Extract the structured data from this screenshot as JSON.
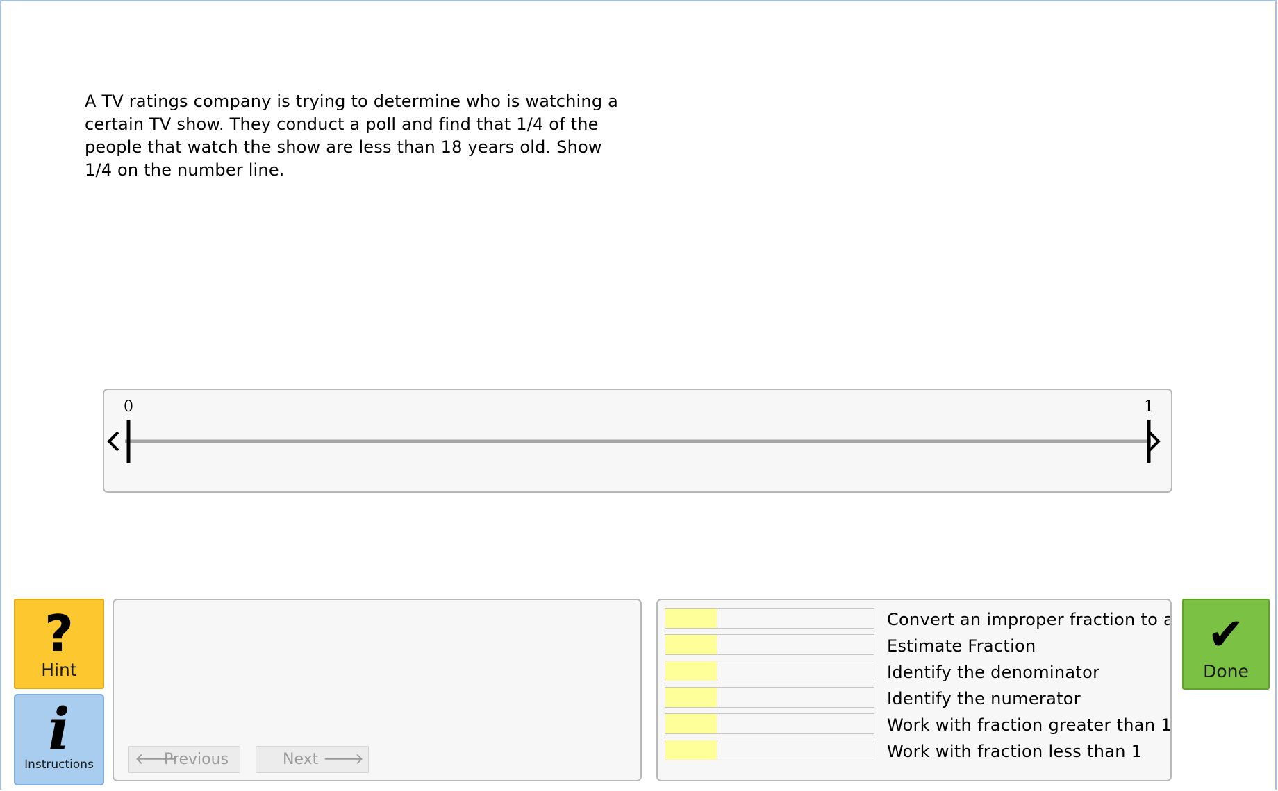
{
  "problem": {
    "text": "A TV ratings company is trying to determine who is watching a certain TV show. They conduct a poll and find that 1/4 of the people that watch the show are less than 18 years old. Show 1/4 on the number line."
  },
  "number_line": {
    "min_label": "0",
    "max_label": "1"
  },
  "buttons": {
    "hint": {
      "icon": "question-mark",
      "glyph": "?",
      "label": "Hint"
    },
    "instructions": {
      "icon": "info",
      "glyph": "i",
      "label": "Instructions"
    },
    "done": {
      "icon": "checkmark",
      "glyph": "✔",
      "label": "Done"
    }
  },
  "navigation": {
    "previous": {
      "label": "Previous",
      "arrow": "🡐"
    },
    "next": {
      "label": "Next",
      "arrow": "🡒"
    }
  },
  "skills": [
    {
      "label": "Convert an improper fraction to a m",
      "level": 0.25
    },
    {
      "label": "Estimate Fraction",
      "level": 0.25
    },
    {
      "label": "Identify the denominator",
      "level": 0.25
    },
    {
      "label": "Identify the numerator",
      "level": 0.25
    },
    {
      "label": "Work with fraction greater than 1",
      "level": 0.25
    },
    {
      "label": "Work with fraction less than 1",
      "level": 0.25
    }
  ],
  "colors": {
    "hint": "#fdc82f",
    "instructions": "#a9cdee",
    "done": "#7bc143",
    "skill_fill": "#ffff99"
  }
}
